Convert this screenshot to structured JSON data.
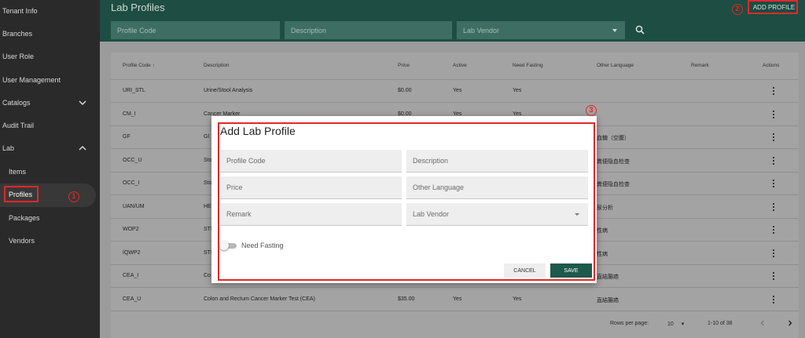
{
  "sidebar": {
    "items": [
      {
        "label": "Tenant Info"
      },
      {
        "label": "Branches"
      },
      {
        "label": "User Role"
      },
      {
        "label": "User Management"
      },
      {
        "label": "Catalogs",
        "icon": "chevron-down-icon"
      },
      {
        "label": "Audit Trail"
      },
      {
        "label": "Lab",
        "icon": "chevron-up-icon"
      },
      {
        "label": "Items"
      },
      {
        "label": "Profiles",
        "active": true
      },
      {
        "label": "Packages"
      },
      {
        "label": "Vendors"
      }
    ]
  },
  "annotations": [
    "1",
    "2",
    "3"
  ],
  "header": {
    "title": "Lab Profiles",
    "add_button": "ADD PROFILE",
    "filters": {
      "profile_code": "Profile Code",
      "description": "Description",
      "lab_vendor": "Lab Vendor"
    },
    "search_icon": "search-icon"
  },
  "table": {
    "columns": {
      "profile_code": "Profile Code",
      "description": "Description",
      "price": "Price",
      "active": "Active",
      "need_fasting": "Need Fasting",
      "other_language": "Other Language",
      "remark": "Remark",
      "actions": "Actions"
    },
    "sort_icon": "arrow-up-icon",
    "rows": [
      {
        "code": "URI_STL",
        "desc": "Urine/Stool Analysis",
        "price": "$0.00",
        "active": "Yes",
        "fasting": "Yes",
        "other": ""
      },
      {
        "code": "CM_I",
        "desc": "Cancer Marker",
        "price": "$0.00",
        "active": "Yes",
        "fasting": "Yes",
        "other": ""
      },
      {
        "code": "GF",
        "desc": "Gl",
        "price": "",
        "active": "",
        "fasting": "",
        "other": "血糖（空腹）"
      },
      {
        "code": "OCC_U",
        "desc": "Sto",
        "price": "",
        "active": "",
        "fasting": "",
        "other": "粪便隐血检查"
      },
      {
        "code": "OCC_I",
        "desc": "Sto",
        "price": "",
        "active": "",
        "fasting": "",
        "other": "粪便隐血检查"
      },
      {
        "code": "UAN/UM",
        "desc": "HE",
        "price": "",
        "active": "",
        "fasting": "",
        "other": "尿分析"
      },
      {
        "code": "WOP2",
        "desc": "STI",
        "price": "",
        "active": "",
        "fasting": "",
        "other": "性病"
      },
      {
        "code": "IQWP2",
        "desc": "STI",
        "price": "",
        "active": "",
        "fasting": "",
        "other": "性病"
      },
      {
        "code": "CEA_I",
        "desc": "Co",
        "price": "",
        "active": "",
        "fasting": "",
        "other": "直結腸癌"
      },
      {
        "code": "CEA_U",
        "desc": "Colon and Rectum Cancer Marker Test (CEA)",
        "price": "$35.00",
        "active": "Yes",
        "fasting": "Yes",
        "other": "直結腸癌"
      }
    ],
    "footer": {
      "rows_per_page_label": "Rows per page:",
      "rows_per_page_value": "10",
      "range": "1-10 of 38"
    }
  },
  "modal": {
    "title": "Add Lab Profile",
    "fields": {
      "profile_code": "Profile Code",
      "description": "Description",
      "price": "Price",
      "other_language": "Other Language",
      "remark": "Remark",
      "lab_vendor": "Lab Vendor"
    },
    "need_fasting_label": "Need Fasting",
    "need_fasting_on": false,
    "cancel": "CANCEL",
    "save": "SAVE"
  },
  "colors": {
    "header": "#1d4d43",
    "sidebar": "#2a2a2a",
    "accent": "#1d5a4c",
    "annotation": "#e0282a"
  }
}
